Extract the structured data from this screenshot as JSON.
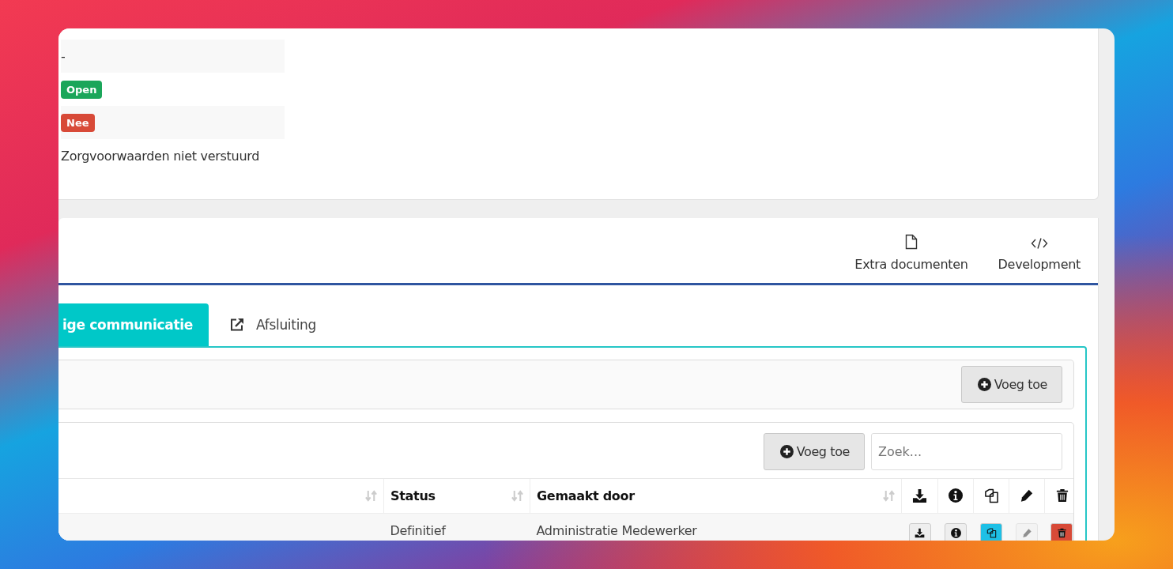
{
  "details": [
    {
      "kind": "text",
      "value": "-"
    },
    {
      "kind": "badge",
      "value": "Open",
      "color": "#1ba65a"
    },
    {
      "kind": "badge",
      "value": "Nee",
      "color": "#d84a38"
    },
    {
      "kind": "text",
      "value": "Zorgvoorwaarden niet verstuurd"
    }
  ],
  "nav": [
    {
      "kind": "file",
      "label": "Extra documenten"
    },
    {
      "kind": "code",
      "label": "Development"
    }
  ],
  "tabs": [
    {
      "kind": "plain",
      "label": "ige communicatie",
      "selected": true
    },
    {
      "kind": "external",
      "label": "Afsluiting",
      "selected": false
    }
  ],
  "section_button": "Voeg toe",
  "table_toolbar": {
    "button": "Voeg toe",
    "search": {
      "placeholder": "Zoek..."
    }
  },
  "table": {
    "columns": [
      {
        "kind": "text",
        "sortable": true
      },
      {
        "kind": "text",
        "label": "Status",
        "sortable": true
      },
      {
        "kind": "text",
        "label": "Gemaakt door",
        "sortable": true
      },
      {
        "kind": "download"
      },
      {
        "kind": "info"
      },
      {
        "kind": "copy"
      },
      {
        "kind": "edit"
      },
      {
        "kind": "delete"
      }
    ],
    "rows": [
      {
        "status": "Definitief",
        "created_by": "Administratie Medewerker",
        "actions": [
          {
            "kind": "download",
            "color": "#eeeeee",
            "disabled": false
          },
          {
            "kind": "info",
            "color": "#eeeeee",
            "disabled": false
          },
          {
            "kind": "copy",
            "color": "#1ec0e6",
            "disabled": false
          },
          {
            "kind": "edit",
            "color": "#eeeeee",
            "disabled": true
          },
          {
            "kind": "delete",
            "color": "#d84a38",
            "disabled": false
          }
        ]
      }
    ]
  }
}
